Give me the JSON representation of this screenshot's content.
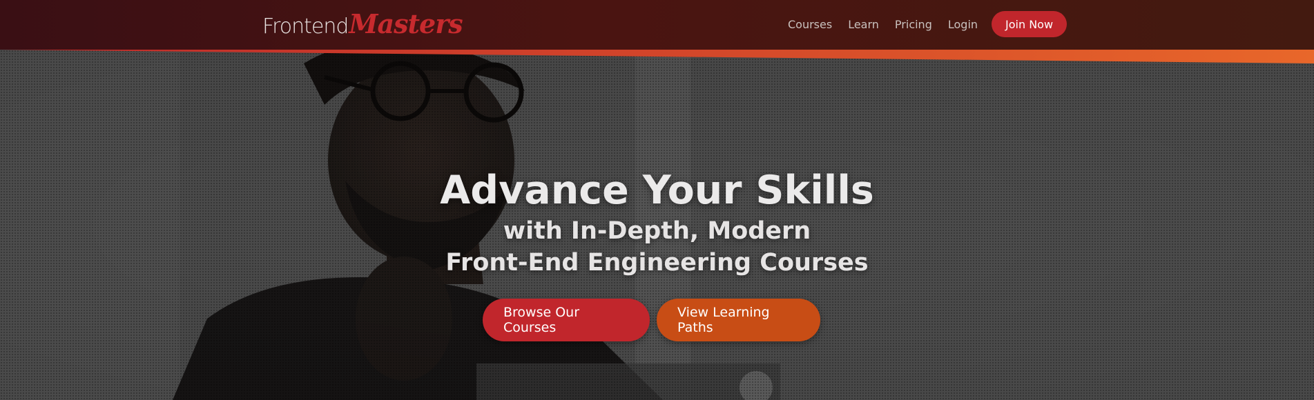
{
  "brand": {
    "logo_part1": "Frontend",
    "logo_part2": "Masters",
    "logo_color": "#c72a2e"
  },
  "nav": {
    "items": [
      {
        "label": "Courses"
      },
      {
        "label": "Learn"
      },
      {
        "label": "Pricing"
      },
      {
        "label": "Login"
      }
    ],
    "join_label": "Join Now"
  },
  "hero": {
    "headline": "Advance Your Skills",
    "subhead_line1": "with In-Depth, Modern",
    "subhead_line2": "Front-End Engineering Courses",
    "primary_cta": "Browse Our Courses",
    "secondary_cta": "View Learning Paths"
  },
  "colors": {
    "primary_red": "#c1262c",
    "accent_orange": "#c84d15",
    "header_bg": "#3a0f14"
  }
}
